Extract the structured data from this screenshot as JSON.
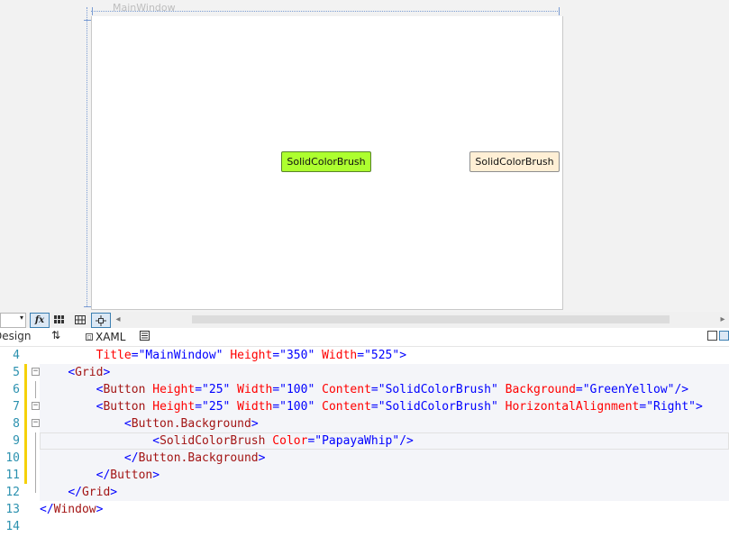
{
  "designer": {
    "window_title": "MainWindow",
    "buttons": [
      {
        "content": "SolidColorBrush",
        "background": "#adff2f"
      },
      {
        "content": "SolidColorBrush",
        "background": "#ffefd5"
      }
    ]
  },
  "toolbar": {
    "zoom": "",
    "fx_label": "fx",
    "grid_icon": "grid-icon",
    "snap_icon": "snap-grid-icon",
    "select_icon": "select-element-icon"
  },
  "tabs": {
    "design_label": "Design",
    "swap_icon_glyph": "⇅",
    "xaml_label": "XAML"
  },
  "code": {
    "lines": [
      {
        "num": "4",
        "indent": "        ",
        "tokens": [
          [
            "attr",
            "Title"
          ],
          [
            "punct",
            "="
          ],
          [
            "val",
            "\"MainWindow\""
          ],
          [
            "attr",
            " Height"
          ],
          [
            "punct",
            "="
          ],
          [
            "val",
            "\"350\""
          ],
          [
            "attr",
            " Width"
          ],
          [
            "punct",
            "="
          ],
          [
            "val",
            "\"525\""
          ],
          [
            "punct",
            ">"
          ]
        ]
      },
      {
        "num": "5",
        "indent": "    ",
        "tokens": [
          [
            "punct",
            "<"
          ],
          [
            "tag",
            "Grid"
          ],
          [
            "punct",
            ">"
          ]
        ]
      },
      {
        "num": "6",
        "indent": "        ",
        "tokens": [
          [
            "punct",
            "<"
          ],
          [
            "tag",
            "Button"
          ],
          [
            "attr",
            " Height"
          ],
          [
            "punct",
            "="
          ],
          [
            "val",
            "\"25\""
          ],
          [
            "attr",
            " Width"
          ],
          [
            "punct",
            "="
          ],
          [
            "val",
            "\"100\""
          ],
          [
            "attr",
            " Content"
          ],
          [
            "punct",
            "="
          ],
          [
            "val",
            "\"SolidColorBrush\""
          ],
          [
            "attr",
            " Background"
          ],
          [
            "punct",
            "="
          ],
          [
            "val",
            "\"GreenYellow\""
          ],
          [
            "punct",
            "/>"
          ]
        ]
      },
      {
        "num": "7",
        "indent": "        ",
        "tokens": [
          [
            "punct",
            "<"
          ],
          [
            "tag",
            "Button"
          ],
          [
            "attr",
            " Height"
          ],
          [
            "punct",
            "="
          ],
          [
            "val",
            "\"25\""
          ],
          [
            "attr",
            " Width"
          ],
          [
            "punct",
            "="
          ],
          [
            "val",
            "\"100\""
          ],
          [
            "attr",
            " Content"
          ],
          [
            "punct",
            "="
          ],
          [
            "val",
            "\"SolidColorBrush\""
          ],
          [
            "attr",
            " HorizontalAlignment"
          ],
          [
            "punct",
            "="
          ],
          [
            "val",
            "\"Right\""
          ],
          [
            "punct",
            ">"
          ]
        ]
      },
      {
        "num": "8",
        "indent": "            ",
        "tokens": [
          [
            "punct",
            "<"
          ],
          [
            "tag",
            "Button.Background"
          ],
          [
            "punct",
            ">"
          ]
        ]
      },
      {
        "num": "9",
        "indent": "                ",
        "tokens": [
          [
            "punct",
            "<"
          ],
          [
            "tag",
            "SolidColorBrush"
          ],
          [
            "attr",
            " Color"
          ],
          [
            "punct",
            "="
          ],
          [
            "val",
            "\"PapayaWhip\""
          ],
          [
            "punct",
            "/>"
          ]
        ]
      },
      {
        "num": "10",
        "indent": "            ",
        "tokens": [
          [
            "punct",
            "</"
          ],
          [
            "tag",
            "Button.Background"
          ],
          [
            "punct",
            ">"
          ]
        ]
      },
      {
        "num": "11",
        "indent": "        ",
        "tokens": [
          [
            "punct",
            "</"
          ],
          [
            "tag",
            "Button"
          ],
          [
            "punct",
            ">"
          ]
        ]
      },
      {
        "num": "12",
        "indent": "    ",
        "tokens": [
          [
            "punct",
            "</"
          ],
          [
            "tag",
            "Grid"
          ],
          [
            "punct",
            ">"
          ]
        ]
      },
      {
        "num": "13",
        "indent": "",
        "tokens": [
          [
            "punct",
            "</"
          ],
          [
            "tag",
            "Window"
          ],
          [
            "punct",
            ">"
          ]
        ]
      },
      {
        "num": "14",
        "indent": "",
        "tokens": []
      }
    ]
  },
  "colors": {
    "accent": "#3c7fb1",
    "change_marker": "#f5d10a"
  }
}
